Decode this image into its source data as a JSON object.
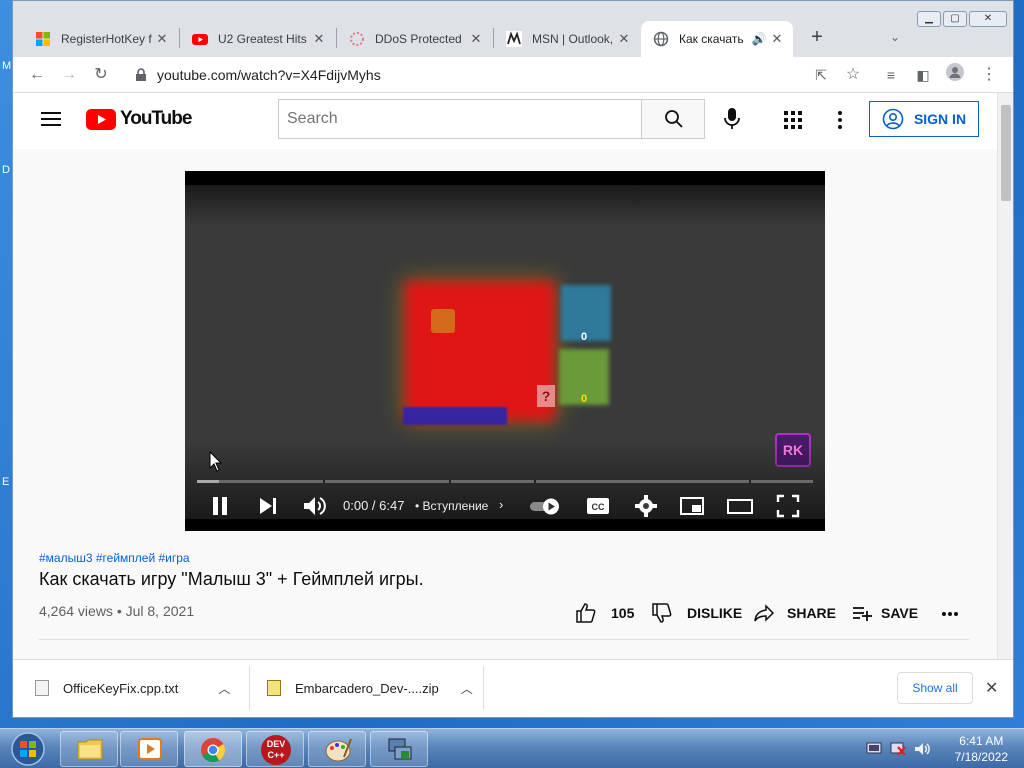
{
  "desktop": {
    "edge_labels": [
      "M",
      "D",
      "E"
    ]
  },
  "browser": {
    "tabs": [
      {
        "title": "RegisterHotKey f"
      },
      {
        "title": "U2 Greatest Hits"
      },
      {
        "title": "DDoS Protected"
      },
      {
        "title": "MSN | Outlook, C"
      },
      {
        "title": "Как скачать"
      }
    ],
    "new_tab_label": "+",
    "address": "youtube.com/watch?v=X4FdijvMyhs"
  },
  "youtube": {
    "logo_text": "YouTube",
    "search_placeholder": "Search",
    "sign_in_label": "SIGN IN",
    "player": {
      "time": "0:00 / 6:47",
      "chapter": "• Вступление",
      "watermark": "RK",
      "counter_top": "0",
      "counter_bottom": "0",
      "card_mark": "?"
    },
    "video": {
      "hashtags": "#малыш3 #геймплей #игра",
      "title": "Как скачать игру \"Малыш 3\" + Геймплей игры.",
      "meta": "4,264 views • Jul 8, 2021",
      "likes": "105",
      "dislike_label": "DISLIKE",
      "share_label": "SHARE",
      "save_label": "SAVE"
    }
  },
  "downloads": {
    "items": [
      {
        "name": "OfficeKeyFix.cpp.txt"
      },
      {
        "name": "Embarcadero_Dev-....zip"
      }
    ],
    "show_all_label": "Show all"
  },
  "taskbar": {
    "time": "6:41 AM",
    "date": "7/18/2022",
    "dev_label": "DEV\nC++"
  },
  "colors": {
    "yt_red": "#ff0000",
    "link_blue": "#065fd4",
    "taskbar": "#3c6aa6"
  }
}
